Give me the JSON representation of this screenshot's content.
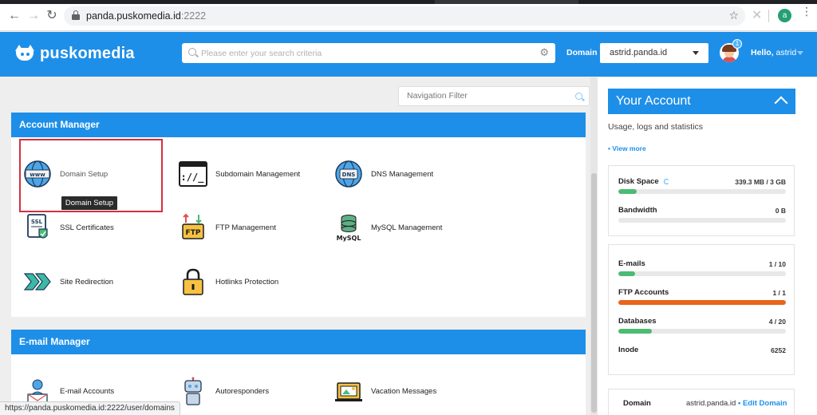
{
  "browser": {
    "url_host": "panda.puskomedia.id",
    "url_port": ":2222",
    "profile_initial": "a",
    "status_url": "https://panda.puskomedia.id:2222/user/domains"
  },
  "header": {
    "brand": "puskomedia",
    "search_placeholder": "Please enter your search criteria",
    "domain_label": "Domain",
    "domain_value": "astrid.panda.id",
    "notification_count": "1",
    "greeting": "Hello,",
    "username": "astrid"
  },
  "main": {
    "nav_filter_placeholder": "Navigation Filter",
    "account_manager": {
      "title": "Account Manager",
      "items": [
        {
          "label": "Domain Setup",
          "icon": "www-globe-icon"
        },
        {
          "label": "Subdomain Management",
          "icon": "terminal-window-icon"
        },
        {
          "label": "DNS Management",
          "icon": "dns-globe-icon"
        },
        {
          "label": "SSL Certificates",
          "icon": "ssl-certificate-icon"
        },
        {
          "label": "FTP Management",
          "icon": "ftp-icon"
        },
        {
          "label": "MySQL Management",
          "icon": "mysql-database-icon"
        },
        {
          "label": "Site Redirection",
          "icon": "redirect-arrows-icon"
        },
        {
          "label": "Hotlinks Protection",
          "icon": "padlock-icon"
        }
      ],
      "tooltip": "Domain Setup"
    },
    "email_manager": {
      "title": "E-mail Manager",
      "items": [
        {
          "label": "E-mail Accounts",
          "icon": "email-account-icon"
        },
        {
          "label": "Autoresponders",
          "icon": "robot-icon"
        },
        {
          "label": "Vacation Messages",
          "icon": "vacation-laptop-icon"
        }
      ]
    }
  },
  "sidebar": {
    "title": "Your Account",
    "subtitle": "Usage, logs and statistics",
    "view_more": "• View more",
    "stats_group1": [
      {
        "name": "Disk Space",
        "value": "339.3 MB / 3 GB",
        "fraction": 0.11,
        "color": "#4cbb73"
      },
      {
        "name": "Bandwidth",
        "value": "0 B",
        "fraction": 0.0,
        "color": "#4cbb73"
      }
    ],
    "stats_group2": [
      {
        "name": "E-mails",
        "value": "1 / 10",
        "fraction": 0.1,
        "color": "#4cbb73"
      },
      {
        "name": "FTP Accounts",
        "value": "1 / 1",
        "fraction": 1.0,
        "color": "#e8651a"
      },
      {
        "name": "Databases",
        "value": "4 / 20",
        "fraction": 0.2,
        "color": "#4cbb73"
      },
      {
        "name": "Inode",
        "value": "6252",
        "fraction": null,
        "color": "#4cbb73"
      }
    ],
    "domain_row": {
      "label": "Domain",
      "value": "astrid.panda.id",
      "edit": "• Edit Domain"
    }
  }
}
